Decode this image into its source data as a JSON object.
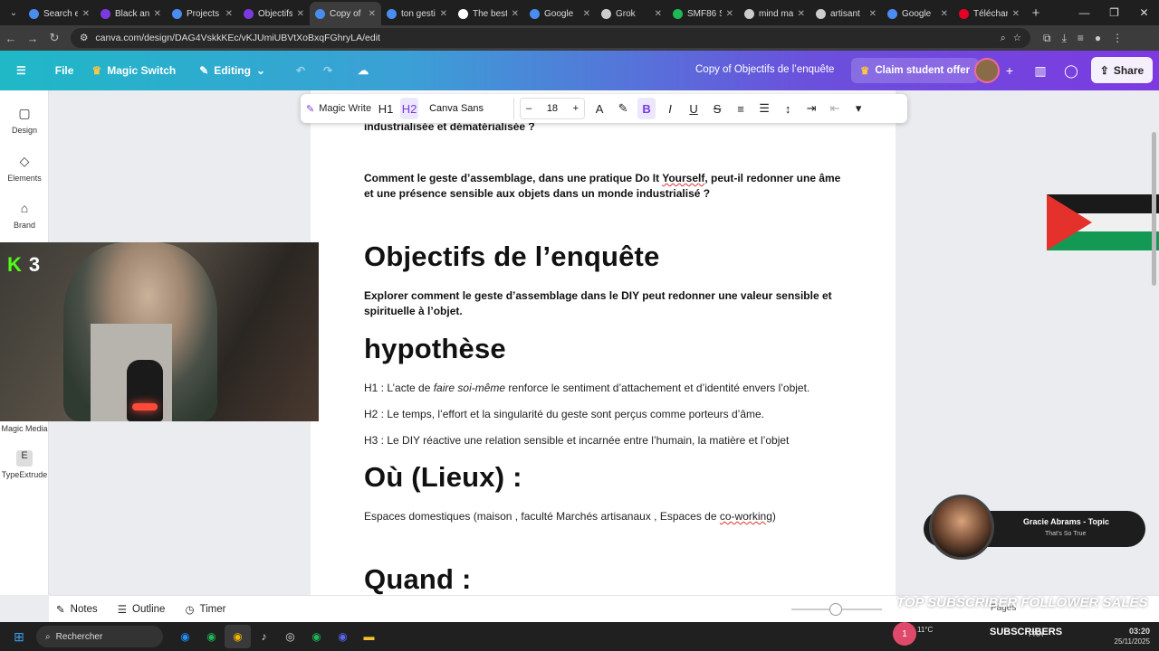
{
  "browser": {
    "tabs": [
      {
        "label": "Search e",
        "color": "#4a8cf0"
      },
      {
        "label": "Black an",
        "color": "#7b3ae0"
      },
      {
        "label": "Projects",
        "color": "#4a8cf0"
      },
      {
        "label": "Objectifs",
        "color": "#7b3ae0"
      },
      {
        "label": "Copy of",
        "color": "#4a8cf0",
        "active": true
      },
      {
        "label": "ton gesti",
        "color": "#4a8cf0"
      },
      {
        "label": "The best",
        "color": "#ffffff"
      },
      {
        "label": "Google",
        "color": "#4a8cf0"
      },
      {
        "label": "Grok",
        "color": "#cccccc"
      },
      {
        "label": "SMF86 S",
        "color": "#1db954"
      },
      {
        "label": "mind ma",
        "color": "#cccccc"
      },
      {
        "label": "artisant",
        "color": "#cccccc"
      },
      {
        "label": "Google",
        "color": "#4a8cf0"
      },
      {
        "label": "Téléchar",
        "color": "#e60023"
      }
    ],
    "url": "canva.com/design/DAG4VskkKEc/vKJUmiUBVtXoBxqFGhryLA/edit"
  },
  "header": {
    "file": "File",
    "magic_switch": "Magic Switch",
    "editing": "Editing",
    "doc_title": "Copy of Objectifs de l’enquête",
    "claim": "Claim student offer",
    "share": "Share"
  },
  "toolbar": {
    "magic_write": "Magic Write",
    "h1": "H1",
    "h2": "H2",
    "font": "Canva Sans",
    "minus": "–",
    "size": "18",
    "plus": "+"
  },
  "sidebar": {
    "items": [
      {
        "label": "Design"
      },
      {
        "label": "Elements"
      },
      {
        "label": "Brand"
      },
      {
        "label": "Magic Media"
      },
      {
        "label": "TypeExtrude"
      }
    ]
  },
  "document": {
    "line0": "industrialisée et dématérialisée ?",
    "q_a": "Comment le geste d’assemblage, dans une pratique Do It ",
    "q_yourself": "Yourself",
    "q_b": ", peut-il redonner une âme et une présence sensible aux objets dans un monde industrialisé ?",
    "obj_title": "Objectifs de l’enquête",
    "obj_text": "Explorer comment le geste d’assemblage dans le DIY peut redonner une valeur sensible et spirituelle à l’objet.",
    "hyp_title": "hypothèse",
    "h1_a": "H1 : L’acte de ",
    "h1_em": "faire soi-même",
    "h1_b": " renforce le sentiment d’attachement et d’identité envers l’objet.",
    "h2": "H2 : Le temps, l’effort et la singularité du geste sont perçus comme porteurs d’âme.",
    "h3": "H3 : Le DIY réactive une relation sensible et incarnée entre l’humain, la matière et l’objet",
    "ou_title": "Où (Lieux) :",
    "ou_a": "Espaces domestiques (maison , faculté   Marchés artisanaux , Espaces de ",
    "ou_cowork": "co-working",
    "ou_b": ")",
    "quand_title": "Quand :"
  },
  "footer": {
    "notes": "Notes",
    "outline": "Outline",
    "timer": "Timer",
    "pages": "Pages"
  },
  "overlay": {
    "kick_count": "3",
    "music_title": "Gracie Abrams - Topic",
    "music_sub": "That’s So True",
    "bottom_text": "TOP SUBSCRIBER FOLLOWER SALES"
  },
  "taskbar": {
    "search": "Rechercher",
    "subscribers": "SUBSCRIBERS",
    "temp": "11°C",
    "lang": "FRA",
    "time": "03:20",
    "date": "25/11/2025",
    "notif": "1"
  }
}
